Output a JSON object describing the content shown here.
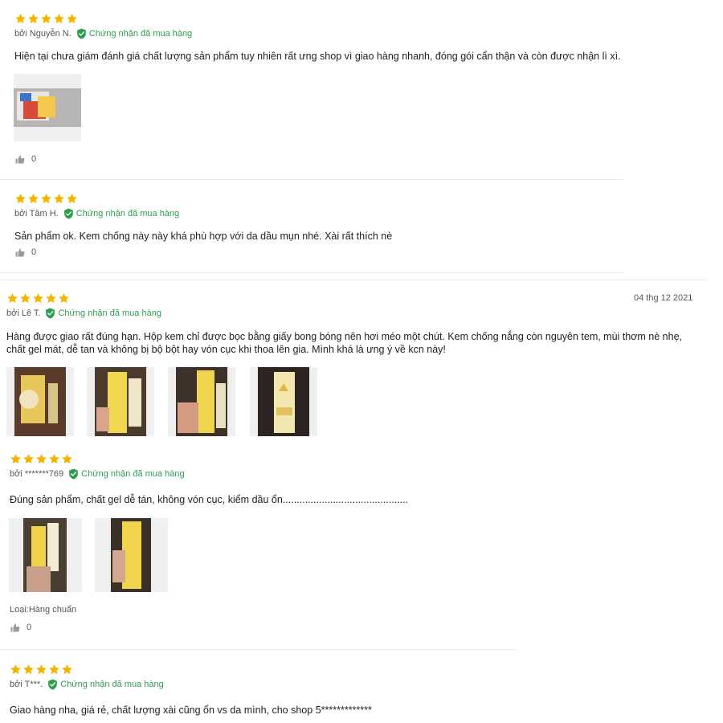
{
  "reviews": [
    {
      "rating": 5,
      "author": "bởi Nguyễn N.",
      "verified": "Chứng nhận đã mua hàng",
      "content": "Hiện tại chưa giám đánh giá chất lượng sản phẩm tuy nhiên rất ưng shop vì giao hàng nhanh, đóng gói cẩn thận và còn được nhận lì xì.",
      "likes": "0",
      "image_count": 1
    },
    {
      "rating": 5,
      "author": "bởi Tâm H.",
      "verified": "Chứng nhận đã mua hàng",
      "content": "Sản phẩm ok. Kem chống này này khá phù hợp với da dầu mụn nhé. Xài rất thích nè",
      "likes": "0"
    },
    {
      "rating": 5,
      "author": "bởi Lê T.",
      "verified": "Chứng nhận đã mua hàng",
      "date": "04 thg 12 2021",
      "content": "Hàng được giao rất đúng hạn. Hộp kem chỉ được bọc bằng giấy bong bóng nên hơi méo một chút. Kem chống nắng còn nguyên tem, mùi thơm nè nhẹ, chất gel mát, dễ tan và không bị bộ bột hay vón cục khi thoa lên gia. Mình khá là ưng ý về kcn này!",
      "image_count": 4
    },
    {
      "rating": 5,
      "author": "bởi *******769",
      "verified": "Chứng nhận đã mua hàng",
      "content": "Đúng sản phẩm, chất gel dễ tán, không vón cục, kiểm dầu ổn.............................................",
      "variant": "Loại:Hàng chuẩn",
      "likes": "0",
      "image_count": 2
    },
    {
      "rating": 5,
      "author": "bởi T***.",
      "verified": "Chứng nhận đã mua hàng",
      "content": "Giao hàng nha, giá rẻ, chất lượng xài cũng ổn vs da mình, cho shop 5*************"
    }
  ],
  "colors": {
    "star": "#f5b400",
    "verified": "#2e9d4e",
    "like_icon": "#9a9a9a"
  },
  "icons": {
    "star": "star-icon",
    "verified": "verified-shield-check-icon",
    "like": "thumbs-up-icon",
    "photo": "product-photo"
  }
}
